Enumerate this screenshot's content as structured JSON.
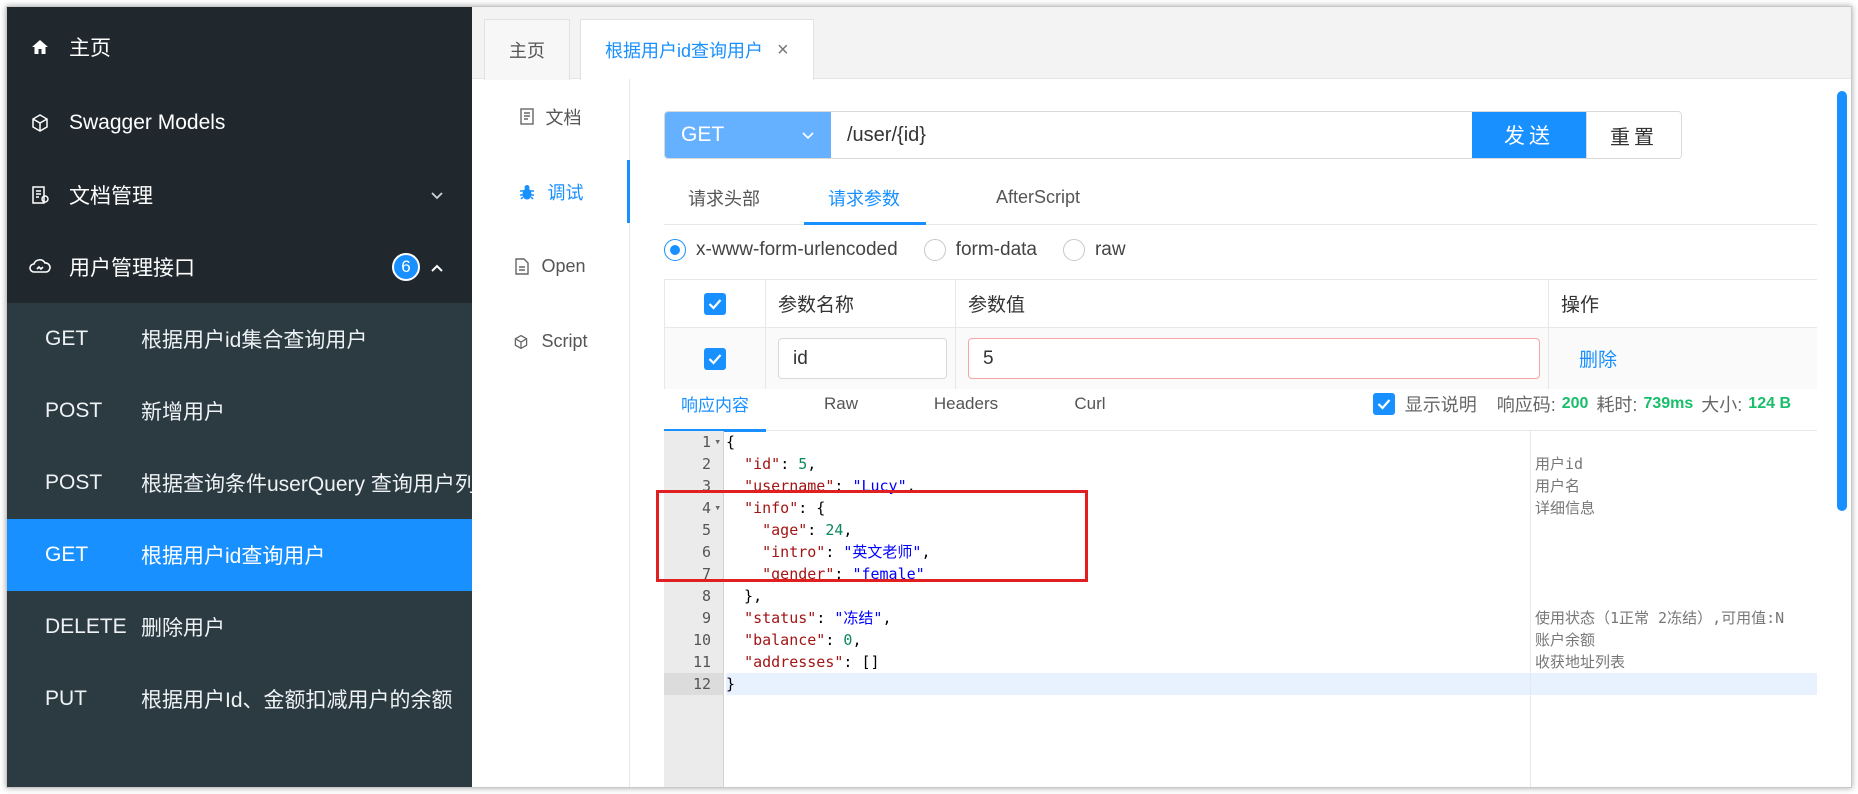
{
  "sidebar": {
    "home": "主页",
    "models": "Swagger Models",
    "docs": "文档管理",
    "group": {
      "label": "用户管理接口",
      "count": "6"
    },
    "items": [
      {
        "method": "GET",
        "label": "根据用户id集合查询用户"
      },
      {
        "method": "POST",
        "label": "新增用户"
      },
      {
        "method": "POST",
        "label": "根据查询条件userQuery 查询用户列"
      },
      {
        "method": "GET",
        "label": "根据用户id查询用户"
      },
      {
        "method": "DELETE",
        "label": "删除用户"
      },
      {
        "method": "PUT",
        "label": "根据用户Id、金额扣减用户的余额"
      }
    ]
  },
  "tabs": {
    "home": "主页",
    "current": "根据用户id查询用户",
    "close": "×"
  },
  "vnav": {
    "doc": "文档",
    "debug": "调试",
    "open": "Open",
    "script": "Script"
  },
  "request": {
    "method": "GET",
    "url": "/user/{id}",
    "send": "发送",
    "reset": "重置",
    "subtabs": [
      "请求头部",
      "请求参数",
      "AfterScript"
    ],
    "content_types": [
      "x-www-form-urlencoded",
      "form-data",
      "raw"
    ],
    "table": {
      "headers": [
        "参数名称",
        "参数值",
        "操作"
      ],
      "row": {
        "name": "id",
        "value": "5",
        "action": "删除"
      }
    }
  },
  "response": {
    "tabs": [
      "响应内容",
      "Raw",
      "Headers",
      "Curl"
    ],
    "show_desc": "显示说明",
    "code_label": "响应码:",
    "code": "200",
    "time_label": "耗时:",
    "time": "739ms",
    "size_label": "大小:",
    "size": "124 B",
    "line_numbers": [
      "1",
      "2",
      "3",
      "4",
      "5",
      "6",
      "7",
      "8",
      "9",
      "10",
      "11",
      "12"
    ],
    "lines": [
      "{",
      "  \"id\": 5,",
      "  \"username\": \"Lucy\",",
      "  \"info\": {",
      "    \"age\": 24,",
      "    \"intro\": \"英文老师\",",
      "    \"gender\": \"female\"",
      "  },",
      "  \"status\": \"冻结\",",
      "  \"balance\": 0,",
      "  \"addresses\": []",
      "}"
    ],
    "descriptions": [
      {
        "line": 2,
        "text": "用户id"
      },
      {
        "line": 3,
        "text": "用户名"
      },
      {
        "line": 4,
        "text": "详细信息"
      },
      {
        "line": 9,
        "text": "使用状态（1正常 2冻结）,可用值:N"
      },
      {
        "line": 10,
        "text": "账户余额"
      },
      {
        "line": 11,
        "text": "收获地址列表"
      }
    ]
  }
}
